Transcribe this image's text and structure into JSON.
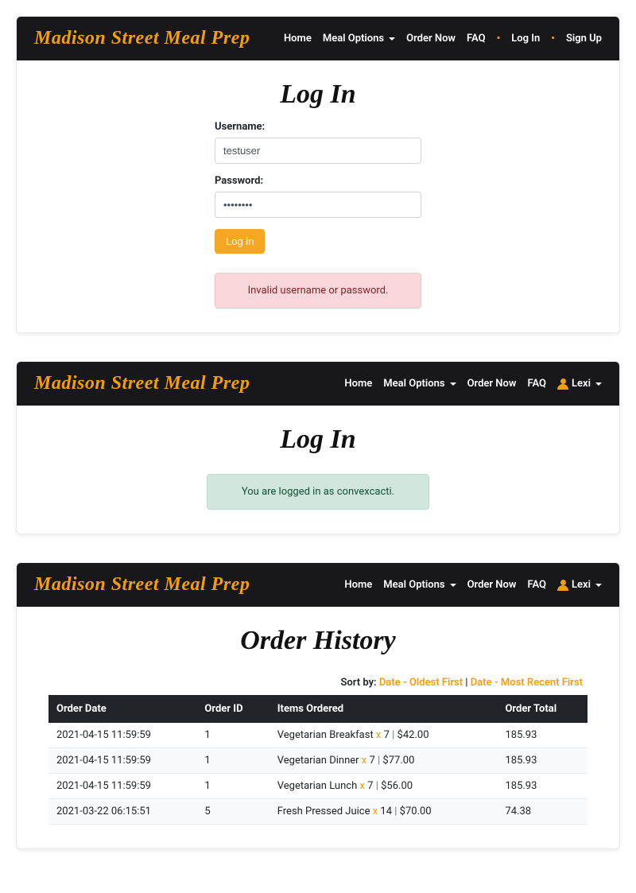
{
  "brand": "Madison Street Meal Prep",
  "nav": {
    "home": "Home",
    "meal_options": "Meal Options",
    "order_now": "Order Now",
    "faq": "FAQ",
    "log_in": "Log In",
    "sign_up": "Sign Up",
    "user_name": "Lexi"
  },
  "panel1": {
    "title": "Log In",
    "username_label": "Username:",
    "username_value": "testuser",
    "password_label": "Password:",
    "password_value": "••••••••",
    "submit": "Log in",
    "error": "Invalid username or password."
  },
  "panel2": {
    "title": "Log In",
    "success": "You are logged in as convexcacti."
  },
  "panel3": {
    "title": "Order History",
    "sort_label": "Sort by:",
    "sort_oldest": "Date - Oldest First",
    "sort_newest": "Date - Most Recent First",
    "headers": {
      "date": "Order Date",
      "id": "Order ID",
      "items": "Items Ordered",
      "total": "Order Total"
    },
    "rows": [
      {
        "date": "2021-04-15 11:59:59",
        "id": "1",
        "item_name": "Vegetarian Breakfast",
        "qty": "7",
        "line_total": "$42.00",
        "total": "185.93"
      },
      {
        "date": "2021-04-15 11:59:59",
        "id": "1",
        "item_name": "Vegetarian Dinner",
        "qty": "7",
        "line_total": "$77.00",
        "total": "185.93"
      },
      {
        "date": "2021-04-15 11:59:59",
        "id": "1",
        "item_name": "Vegetarian Lunch",
        "qty": "7",
        "line_total": "$56.00",
        "total": "185.93"
      },
      {
        "date": "2021-03-22 06:15:51",
        "id": "5",
        "item_name": "Fresh Pressed Juice",
        "qty": "14",
        "line_total": "$70.00",
        "total": "74.38"
      }
    ]
  }
}
